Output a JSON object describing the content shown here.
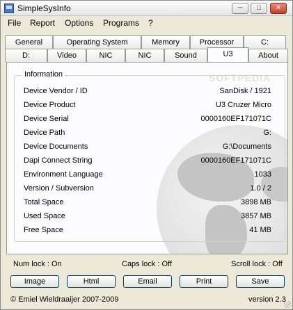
{
  "window": {
    "title": "SimpleSysInfo",
    "controls": {
      "minimize": "─",
      "maximize": "□",
      "close": "✕"
    }
  },
  "menu": [
    "File",
    "Report",
    "Options",
    "Programs",
    "?"
  ],
  "tabs_row1": [
    "General",
    "Operating System",
    "Memory",
    "Processor",
    "C:"
  ],
  "tabs_row2": [
    "D:",
    "Video",
    "NIC",
    "NIC",
    "Sound",
    "U3",
    "About"
  ],
  "active_tab": "U3",
  "watermark": "SOFTPEDIA",
  "info": {
    "group_label": "Information",
    "rows": [
      {
        "label": "Device Vendor / ID",
        "value": "SanDisk / 1921"
      },
      {
        "label": "Device Product",
        "value": "U3 Cruzer Micro"
      },
      {
        "label": "Device Serial",
        "value": "0000160EF171071C"
      },
      {
        "label": "Device Path",
        "value": "G:"
      },
      {
        "label": "Device Documents",
        "value": "G:\\Documents"
      },
      {
        "label": "Dapi Connect String",
        "value": "0000160EF171071C"
      },
      {
        "label": "Environment Language",
        "value": "1033"
      },
      {
        "label": "Version / Subversion",
        "value": "1.0 /  2"
      },
      {
        "label": "Total Space",
        "value": "3898 MB"
      },
      {
        "label": "Used Space",
        "value": "3857 MB"
      },
      {
        "label": "Free Space",
        "value": "41 MB"
      }
    ]
  },
  "status": {
    "num_lock": "Num lock : On",
    "caps_lock": "Caps lock : Off",
    "scroll_lock": "Scroll lock : Off"
  },
  "buttons": [
    "Image",
    "Html",
    "Email",
    "Print",
    "Save"
  ],
  "footer": {
    "copyright": "© Emiel Wieldraaijer 2007-2009",
    "version": "version 2.3"
  }
}
